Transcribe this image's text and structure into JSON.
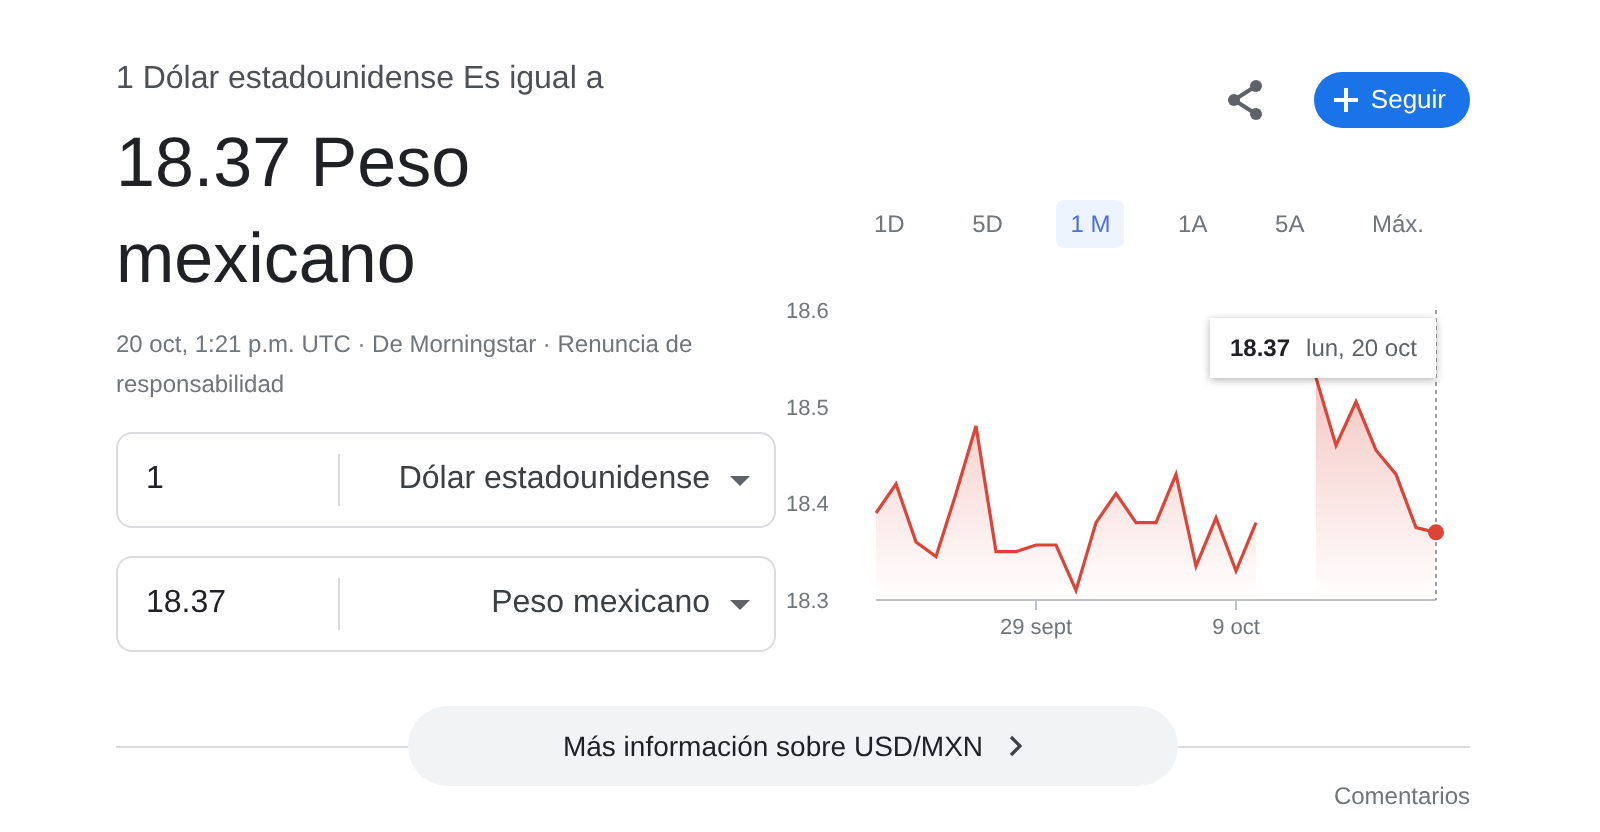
{
  "header": {
    "subtitle": "1 Dólar estadounidense Es igual a",
    "result": "18.37 Peso mexicano",
    "meta": "20 oct, 1:21 p.m. UTC · De Morningstar · Renuncia de responsabilidad"
  },
  "follow_button": {
    "label": "Seguir"
  },
  "converter": [
    {
      "value": "1",
      "currency": "Dólar estadounidense"
    },
    {
      "value": "18.37",
      "currency": "Peso mexicano"
    }
  ],
  "range_tabs": [
    {
      "label": "1D",
      "selected": false
    },
    {
      "label": "5D",
      "selected": false
    },
    {
      "label": "1 M",
      "selected": true
    },
    {
      "label": "1A",
      "selected": false
    },
    {
      "label": "5A",
      "selected": false
    },
    {
      "label": "Máx.",
      "selected": false
    }
  ],
  "chart": {
    "tooltip": {
      "value": "18.37",
      "date": "lun, 20 oct"
    },
    "chart_data": {
      "type": "area",
      "categories": [
        null,
        null,
        null,
        null,
        null,
        null,
        null,
        null,
        "29 sept",
        null,
        null,
        null,
        null,
        null,
        null,
        null,
        null,
        null,
        "9 oct",
        null,
        null,
        null,
        null,
        null,
        null,
        null,
        null,
        null,
        null
      ],
      "series": [
        {
          "color": "#db4437",
          "values": [
            18.39,
            18.42,
            18.36,
            18.345,
            18.41,
            18.48,
            18.35,
            18.35,
            18.357,
            18.357,
            18.31,
            18.38,
            18.41,
            18.38,
            18.38,
            18.43,
            18.335,
            18.385,
            18.33,
            18.38,
            null,
            null,
            18.53,
            18.46,
            18.505,
            18.455,
            18.43,
            18.375,
            18.37
          ]
        }
      ],
      "ylim": [
        18.3,
        18.6
      ],
      "yticks": [
        {
          "value": 18.3,
          "label": "18.3"
        },
        {
          "value": 18.4,
          "label": "18.4"
        },
        {
          "value": 18.5,
          "label": "18.5"
        },
        {
          "value": 18.6,
          "label": "18.6"
        }
      ]
    }
  },
  "footer": {
    "more_info": "Más información sobre USD/MXN",
    "feedback": "Comentarios"
  }
}
